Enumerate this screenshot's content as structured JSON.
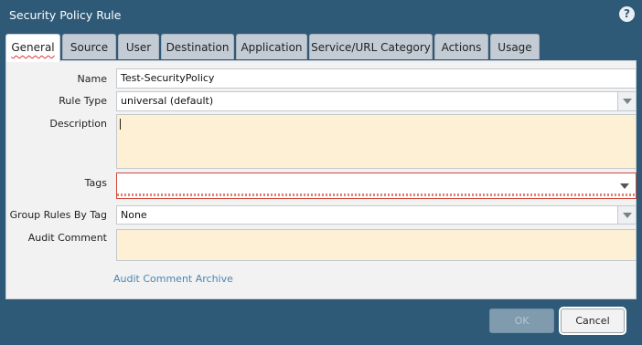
{
  "dialog": {
    "title": "Security Policy Rule",
    "help_icon": "?"
  },
  "tabs": [
    {
      "label": "General",
      "active": true
    },
    {
      "label": "Source"
    },
    {
      "label": "User"
    },
    {
      "label": "Destination"
    },
    {
      "label": "Application"
    },
    {
      "label": "Service/URL Category"
    },
    {
      "label": "Actions"
    },
    {
      "label": "Usage"
    }
  ],
  "form": {
    "name": {
      "label": "Name",
      "value": "Test-SecurityPolicy"
    },
    "rule_type": {
      "label": "Rule Type",
      "value": "universal (default)"
    },
    "description": {
      "label": "Description",
      "value": ""
    },
    "tags": {
      "label": "Tags",
      "value": ""
    },
    "group_rules_by_tag": {
      "label": "Group Rules By Tag",
      "value": "None"
    },
    "audit_comment": {
      "label": "Audit Comment",
      "value": ""
    },
    "audit_comment_archive": "Audit Comment Archive"
  },
  "buttons": {
    "ok": "OK",
    "cancel": "Cancel"
  },
  "colors": {
    "dialog_bg": "#2e5a78",
    "panel_bg": "#f2f2f2",
    "textarea_bg": "#fdf0d5",
    "error_border": "#d04a3a",
    "link": "#4a86b4"
  }
}
